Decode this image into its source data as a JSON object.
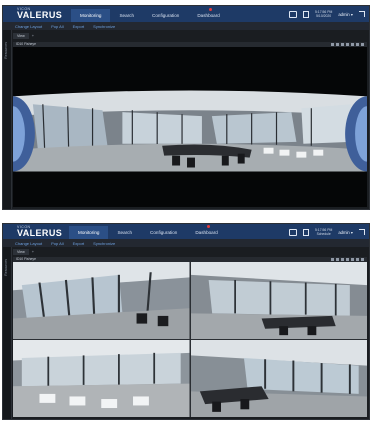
{
  "app": {
    "brand_sub": "VICON",
    "brand": "VALERUS",
    "nav": [
      {
        "label": "Monitoring",
        "active": true
      },
      {
        "label": "Search",
        "active": false
      },
      {
        "label": "Configuration",
        "active": false
      },
      {
        "label": "Dashboard",
        "active": false,
        "badge": true
      }
    ],
    "clock_time": "5:17:56 PM",
    "clock_sub": "5/10/2020",
    "clock_sub_bottom": "Schedule",
    "user": "admin",
    "actions": [
      "Change Layout",
      "Pop All",
      "Export",
      "Synchronize"
    ],
    "view_tab": "View",
    "view_add": "+",
    "rail_label": "Resources",
    "camera_name": "ID10 Fisheye"
  },
  "colors": {
    "header": "#1e3a66",
    "active_tab": "#2b4f86",
    "link": "#6da0e0",
    "badge": "#e23b3b"
  }
}
